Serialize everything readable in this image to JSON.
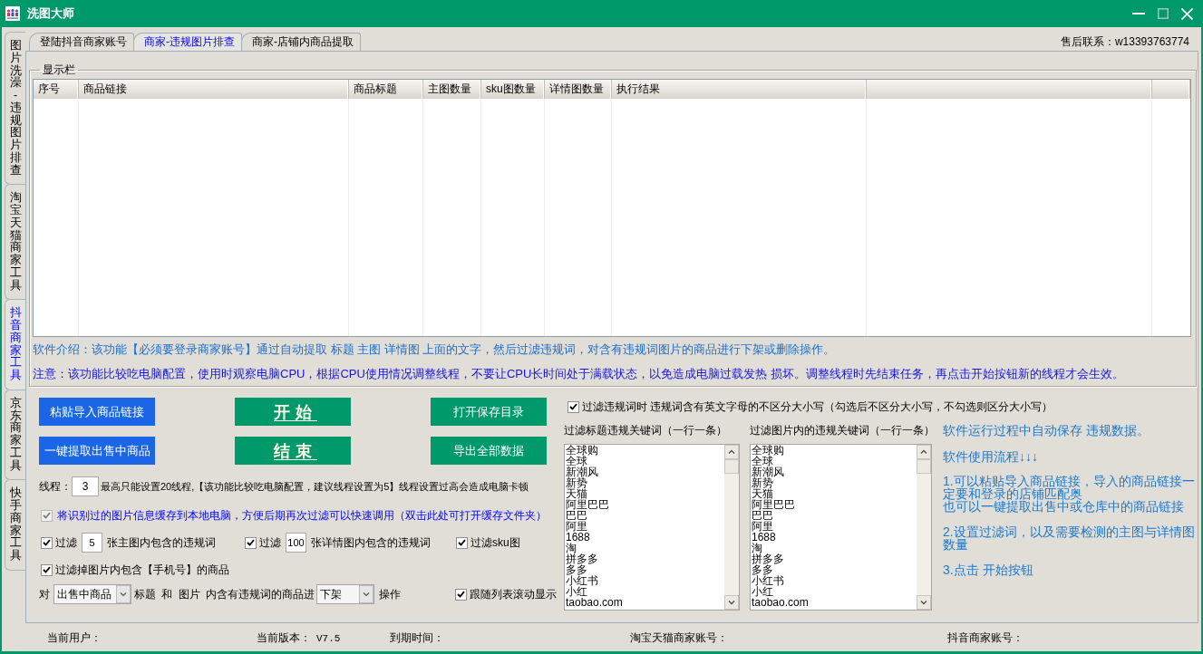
{
  "window": {
    "title": "洗图大师",
    "controls": [
      {
        "kind": "minimize",
        "disabled": false
      },
      {
        "kind": "maximize",
        "disabled": true
      },
      {
        "kind": "close",
        "disabled": false
      }
    ]
  },
  "side_tabs": [
    {
      "label": "图片洗澡-违规图片排查",
      "selected": false
    },
    {
      "label": "淘宝天猫商家工具",
      "selected": false
    },
    {
      "label": "抖音商家工具",
      "selected": true
    },
    {
      "label": "京东商家工具",
      "selected": false
    },
    {
      "label": "快手商家工具",
      "selected": false
    }
  ],
  "tabs": [
    {
      "label": "登陆抖音商家账号",
      "selected": false
    },
    {
      "label": "商家-违规图片排查",
      "selected": true
    },
    {
      "label": "商家-店铺内商品提取",
      "selected": false
    }
  ],
  "support_contact": "售后联系：w13393763774",
  "display_group": {
    "title": "显示栏",
    "table": {
      "columns": [
        "序号",
        "商品链接",
        "商品标题",
        "主图数量",
        "sku图数量",
        "详情图数量",
        "执行结果"
      ]
    },
    "notes": [
      {
        "kind": "intro",
        "text": "软件介绍：该功能【必须要登录商家账号】通过自动提取 标题 主图 详情图 上面的文字，然后过滤违规词，对含有违规词图片的商品进行下架或删除操作。"
      },
      {
        "kind": "warning",
        "text": "注意：该功能比较吃电脑配置，使用时观察电脑CPU，根据CPU使用情况调整线程，不要让CPU长时间处于满载状态，以免造成电脑过载发热 损坏。调整线程时先结束任务，再点击开始按钮新的线程才会生效。"
      }
    ]
  },
  "buttons": [
    {
      "label": "粘贴导入商品链接",
      "kind": "import"
    },
    {
      "label": "开始",
      "kind": "control"
    },
    {
      "label": "打开保存目录",
      "kind": "output"
    },
    {
      "label": "一键提取出售中商品",
      "kind": "import"
    },
    {
      "label": "结束",
      "kind": "control"
    },
    {
      "label": "导出全部数据",
      "kind": "output"
    }
  ],
  "threads": {
    "label": "线程：",
    "value": "3",
    "hint": "最高只能设置20线程,【该功能比较吃电脑配置，建议线程设置为5】线程设置过高会造成电脑卡顿"
  },
  "cache_option": {
    "label": "将识别过的图片信息缓存到本地电脑，方便后期再次过滤可以快速调用（双击此处可打开缓存文件夹）",
    "checked": true,
    "disabled": true
  },
  "filters": [
    {
      "kind": "count",
      "checked": true,
      "label": "过滤",
      "value": "5",
      "suffix": "张主图内包含的违规词"
    },
    {
      "kind": "count",
      "checked": true,
      "label": "过滤",
      "value": "100",
      "suffix": "张详情图内包含的违规词"
    },
    {
      "kind": "plain",
      "checked": true,
      "label": "过滤sku图"
    }
  ],
  "phone_filter": {
    "label": "过滤掉图片内包含【手机号】的商品",
    "checked": true
  },
  "action_rule": {
    "prefix": "对",
    "scope": "出售中商品",
    "middle": "标题 和 图片 内含有违规词的商品进",
    "operation": "下架",
    "suffix": "操作"
  },
  "follow_scroll": {
    "label": "跟随列表滚动显示",
    "checked": true
  },
  "case_option": {
    "label": "过滤违规词时 违规词含有英文字母的不区分大小写（勾选后不区分大小写，不勾选则区分大小写）",
    "checked": true
  },
  "keyword_lists": [
    {
      "label": "过滤标题违规关键词（一行一条）",
      "lines": [
        "全球购",
        "全球",
        "新潮风",
        "新势",
        "天猫",
        "阿里巴巴",
        "巴巴",
        "阿里",
        "1688",
        "淘",
        "拼多多",
        "多多",
        "小红书",
        "小红",
        "taobao.com"
      ]
    },
    {
      "label": "过滤图片内的违规关键词（一行一条）",
      "lines": [
        "全球购",
        "全球",
        "新潮风",
        "新势",
        "天猫",
        "阿里巴巴",
        "巴巴",
        "阿里",
        "1688",
        "淘",
        "拼多多",
        "多多",
        "小红书",
        "小红",
        "taobao.com"
      ]
    }
  ],
  "help": {
    "lines": [
      "软件运行过程中自动保存 违规数据。",
      "软件使用流程↓↓↓"
    ],
    "steps": [
      [
        "1.可以粘贴导入商品链接，导入的商品链接一定要和登录的店铺匹配奥",
        "也可以一键提取出售中或仓库中的商品链接"
      ],
      [
        "2.设置过滤词，以及需要检测的主图与详情图数量"
      ],
      [
        "3.点击 开始按钮"
      ]
    ]
  },
  "status_bar": [
    {
      "label": "当前用户："
    },
    {
      "label": "当前版本：",
      "value": "V7.5"
    },
    {
      "label": "到期时间："
    },
    {
      "label": "淘宝天猫商家账号："
    },
    {
      "label": "抖音商家账号："
    }
  ]
}
